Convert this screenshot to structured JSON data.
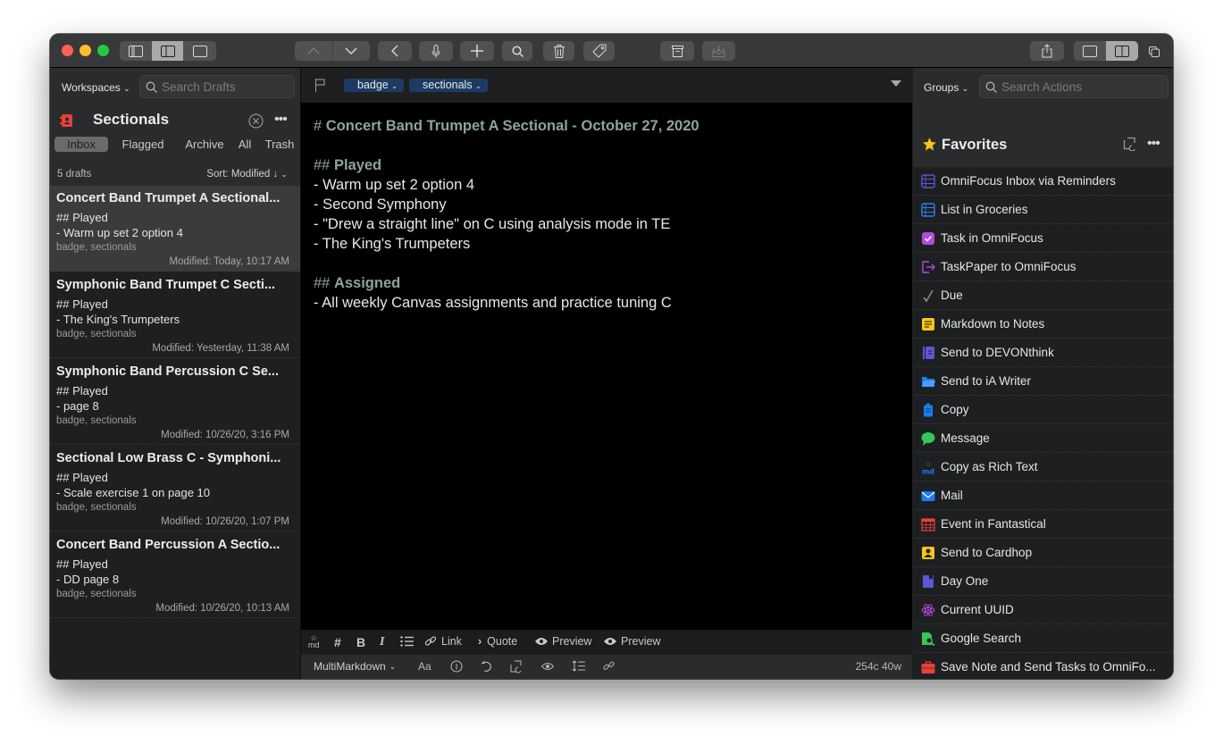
{
  "toolbar": {
    "buttons": [
      "sidebar-left",
      "sidebar-middle",
      "sidebar-none",
      "previous",
      "next",
      "back",
      "dictate",
      "new-draft",
      "search",
      "trash",
      "tag",
      "archive",
      "inbox",
      "share",
      "layout-single",
      "layout-split",
      "window"
    ]
  },
  "sidebar": {
    "workspaces_label": "Workspaces",
    "search_placeholder": "Search Drafts",
    "workspace_title": "Sectionals",
    "workspace_color": "#e8403a",
    "tabs": [
      {
        "label": "Inbox",
        "active": true
      },
      {
        "label": "Flagged",
        "active": false
      },
      {
        "label": "Archive",
        "active": false
      },
      {
        "label": "All",
        "active": false
      },
      {
        "label": "Trash",
        "active": false
      }
    ],
    "count_label": "5 drafts",
    "sort_label": "Sort: Modified ↓",
    "drafts": [
      {
        "title": "Concert Band Trumpet A Sectional...",
        "line1": "## Played",
        "line2": "- Warm up set 2 option 4",
        "tags": "badge, sectionals",
        "modified": "Modified: Today, 10:17 AM",
        "selected": true
      },
      {
        "title": "Symphonic Band Trumpet C Secti...",
        "line1": "## Played",
        "line2": "- The King's Trumpeters",
        "tags": "badge, sectionals",
        "modified": "Modified: Yesterday, 11:38 AM",
        "selected": false
      },
      {
        "title": "Symphonic Band Percussion C Se...",
        "line1": "## Played",
        "line2": "- page 8",
        "tags": "badge, sectionals",
        "modified": "Modified: 10/26/20, 3:16 PM",
        "selected": false
      },
      {
        "title": "Sectional Low Brass C - Symphoni...",
        "line1": "## Played",
        "line2": "- Scale exercise 1 on page 10",
        "tags": "badge, sectionals",
        "modified": "Modified: 10/26/20, 1:07 PM",
        "selected": false
      },
      {
        "title": "Concert Band Percussion A Sectio...",
        "line1": "## Played",
        "line2": "- DD page 8",
        "tags": "badge, sectionals",
        "modified": "Modified: 10/26/20, 10:13 AM",
        "selected": false
      }
    ]
  },
  "editor": {
    "tags": [
      "badge",
      "sectionals"
    ],
    "lines": [
      {
        "marker": "# ",
        "text": "Concert Band Trumpet A Sectional - October 27, 2020",
        "heading": true
      },
      {
        "marker": "",
        "text": "",
        "heading": false
      },
      {
        "marker": "## ",
        "text": "Played",
        "heading": true
      },
      {
        "marker": "",
        "text": "- Warm up set 2 option 4",
        "heading": false
      },
      {
        "marker": "",
        "text": "- Second Symphony",
        "heading": false
      },
      {
        "marker": "",
        "text": "- \"Drew a straight line\" on C using analysis mode in TE",
        "heading": false
      },
      {
        "marker": "",
        "text": "- The King's Trumpeters",
        "heading": false
      },
      {
        "marker": "",
        "text": "",
        "heading": false
      },
      {
        "marker": "## ",
        "text": "Assigned",
        "heading": true
      },
      {
        "marker": "",
        "text": "- All weekly Canvas assignments and practice tuning C",
        "heading": false
      }
    ],
    "keyboard_bar": {
      "link_label": "Link",
      "quote_label": "Quote",
      "preview1_label": "Preview",
      "preview2_label": "Preview"
    },
    "status": {
      "syntax": "MultiMarkdown",
      "font_label": "Aa",
      "counts": "254c 40w"
    }
  },
  "actions": {
    "groups_label": "Groups",
    "search_placeholder": "Search Actions",
    "group_title": "Favorites",
    "items": [
      {
        "label": "OmniFocus Inbox via Reminders",
        "icon": "list-icon",
        "color": "#5b57d6"
      },
      {
        "label": "List in Groceries",
        "icon": "list-icon",
        "color": "#2a7ff0"
      },
      {
        "label": "Task in OmniFocus",
        "icon": "checkbox-icon",
        "color": "#b24be0"
      },
      {
        "label": "TaskPaper to OmniFocus",
        "icon": "export-icon",
        "color": "#b24be0"
      },
      {
        "label": "Due",
        "icon": "checkmark-icon",
        "color": "#8a8a8a"
      },
      {
        "label": "Markdown to Notes",
        "icon": "note-icon",
        "color": "#f5c71a"
      },
      {
        "label": "Send to DEVONthink",
        "icon": "notebook-icon",
        "color": "#5b57d6"
      },
      {
        "label": "Send to iA Writer",
        "icon": "folder-icon",
        "color": "#1a7cf0"
      },
      {
        "label": "Copy",
        "icon": "clipboard-icon",
        "color": "#1a7cf0"
      },
      {
        "label": "Message",
        "icon": "message-icon",
        "color": "#34c759"
      },
      {
        "label": "Copy as Rich Text",
        "icon": "markdown-icon",
        "color": "#1a7cf0"
      },
      {
        "label": "Mail",
        "icon": "mail-icon",
        "color": "#1a7cf0"
      },
      {
        "label": "Event in Fantastical",
        "icon": "calendar-icon",
        "color": "#e8403a"
      },
      {
        "label": "Send to Cardhop",
        "icon": "contact-icon",
        "color": "#f5c71a"
      },
      {
        "label": "Day One",
        "icon": "bookmark-icon",
        "color": "#5b57d6"
      },
      {
        "label": "Current UUID",
        "icon": "atom-icon",
        "color": "#b24be0"
      },
      {
        "label": "Google Search",
        "icon": "search-doc-icon",
        "color": "#34c759"
      },
      {
        "label": "Save Note and Send Tasks to OmniFo...",
        "icon": "briefcase-icon",
        "color": "#e8403a"
      }
    ]
  }
}
